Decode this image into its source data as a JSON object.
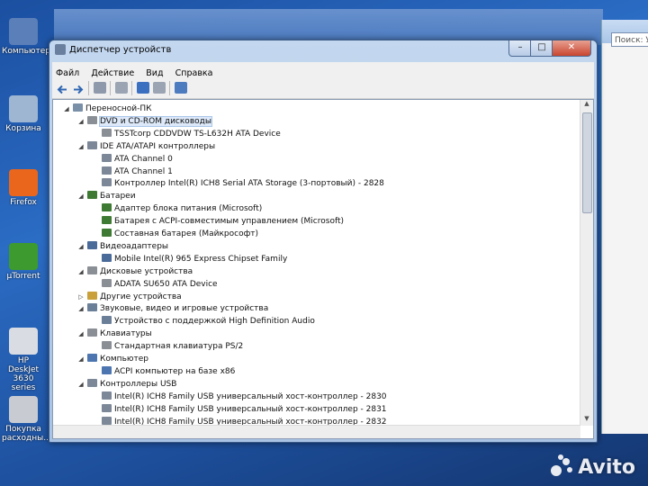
{
  "desktop": {
    "icons": [
      {
        "label": "Компьютер",
        "color": "#5b7fb8"
      },
      {
        "label": "Корзина",
        "color": "#9fb6d3"
      },
      {
        "label": "Firefox",
        "color": "#e9661c"
      },
      {
        "label": "µTorrent",
        "color": "#3c9a2e"
      },
      {
        "label": "HP DeskJet 3630 series",
        "color": "#d9dde3"
      },
      {
        "label": "Покупка расходны...",
        "color": "#c8ccd2"
      }
    ],
    "bg_search_placeholder": "Поиск: У"
  },
  "window": {
    "title": "Диспетчер устройств",
    "min_label": "–",
    "max_label": "□",
    "close_label": "✕"
  },
  "menu": [
    "Файл",
    "Действие",
    "Вид",
    "Справка"
  ],
  "tree": [
    {
      "label": "Переносной-ПК",
      "level": 0,
      "expanded": true,
      "color": "#7a8fa8"
    },
    {
      "label": "DVD и CD-ROM дисководы",
      "level": 1,
      "expanded": true,
      "selected": true,
      "color": "#8a8f96"
    },
    {
      "label": "TSSTcorp CDDVDW TS-L632H ATA Device",
      "level": 2,
      "color": "#8a8f96"
    },
    {
      "label": "IDE ATA/ATAPI контроллеры",
      "level": 1,
      "expanded": true,
      "color": "#7c8898"
    },
    {
      "label": "ATA Channel 0",
      "level": 2,
      "color": "#7c8898"
    },
    {
      "label": "ATA Channel 1",
      "level": 2,
      "color": "#7c8898"
    },
    {
      "label": "Контроллер Intel(R) ICH8 Serial ATA Storage (3-портовый) - 2828",
      "level": 2,
      "color": "#7c8898"
    },
    {
      "label": "Батареи",
      "level": 1,
      "expanded": true,
      "color": "#3f7a34"
    },
    {
      "label": "Адаптер блока питания (Microsoft)",
      "level": 2,
      "color": "#3f7a34"
    },
    {
      "label": "Батарея с ACPI-совместимым управлением (Microsoft)",
      "level": 2,
      "color": "#3f7a34"
    },
    {
      "label": "Составная батарея (Майкрософт)",
      "level": 2,
      "color": "#3f7a34"
    },
    {
      "label": "Видеоадаптеры",
      "level": 1,
      "expanded": true,
      "color": "#4a6b9a"
    },
    {
      "label": "Mobile Intel(R) 965 Express Chipset Family",
      "level": 2,
      "color": "#4a6b9a"
    },
    {
      "label": "Дисковые устройства",
      "level": 1,
      "expanded": true,
      "color": "#8a8f96"
    },
    {
      "label": "ADATA SU650 ATA Device",
      "level": 2,
      "color": "#8a8f96"
    },
    {
      "label": "Другие устройства",
      "level": 1,
      "expanded": false,
      "color": "#c9a03a"
    },
    {
      "label": "Звуковые, видео и игровые устройства",
      "level": 1,
      "expanded": true,
      "color": "#6b7f99"
    },
    {
      "label": "Устройство с поддержкой High Definition Audio",
      "level": 2,
      "color": "#6b7f99"
    },
    {
      "label": "Клавиатуры",
      "level": 1,
      "expanded": true,
      "color": "#8a8f96"
    },
    {
      "label": "Стандартная клавиатура PS/2",
      "level": 2,
      "color": "#8a8f96"
    },
    {
      "label": "Компьютер",
      "level": 1,
      "expanded": true,
      "color": "#4d76b0"
    },
    {
      "label": "ACPI компьютер на базе x86",
      "level": 2,
      "color": "#4d76b0"
    },
    {
      "label": "Контроллеры USB",
      "level": 1,
      "expanded": true,
      "color": "#7c8898"
    },
    {
      "label": "Intel(R) ICH8 Family USB универсальный хост-контроллер - 2830",
      "level": 2,
      "color": "#7c8898"
    },
    {
      "label": "Intel(R) ICH8 Family USB универсальный хост-контроллер - 2831",
      "level": 2,
      "color": "#7c8898"
    },
    {
      "label": "Intel(R) ICH8 Family USB универсальный хост-контроллер - 2832",
      "level": 2,
      "color": "#7c8898"
    }
  ],
  "watermark": "Avito"
}
